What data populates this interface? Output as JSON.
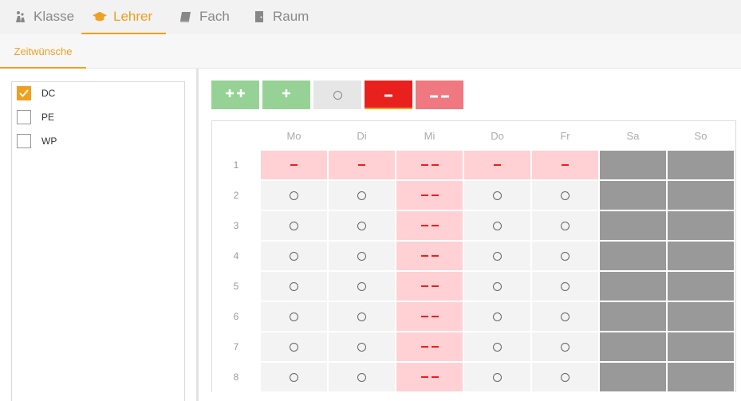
{
  "tabs": [
    {
      "label": "Klasse",
      "icon": "people-icon",
      "active": false
    },
    {
      "label": "Lehrer",
      "icon": "graduation-cap-icon",
      "active": true
    },
    {
      "label": "Fach",
      "icon": "book-icon",
      "active": false
    },
    {
      "label": "Raum",
      "icon": "door-icon",
      "active": false
    }
  ],
  "subtab": {
    "label": "Zeitwünsche"
  },
  "teachers": [
    {
      "label": "DC",
      "checked": true
    },
    {
      "label": "PE",
      "checked": false
    },
    {
      "label": "WP",
      "checked": false
    }
  ],
  "modes": [
    "++",
    "+",
    "○",
    "−",
    "−−"
  ],
  "colors": {
    "accent": "#f0a020",
    "positive": "#96d296",
    "negative": "#e8201e",
    "negative_soft": "#f07880",
    "blocked": "#999999"
  },
  "days": [
    "Mo",
    "Di",
    "Mi",
    "Do",
    "Fr",
    "Sa",
    "So"
  ],
  "periods": [
    "1",
    "2",
    "3",
    "4",
    "5",
    "6",
    "7",
    "8"
  ],
  "preferences": [
    [
      "-",
      "-",
      "--",
      "-",
      "-",
      "x",
      "x"
    ],
    [
      "o",
      "o",
      "--",
      "o",
      "o",
      "x",
      "x"
    ],
    [
      "o",
      "o",
      "--",
      "o",
      "o",
      "x",
      "x"
    ],
    [
      "o",
      "o",
      "--",
      "o",
      "o",
      "x",
      "x"
    ],
    [
      "o",
      "o",
      "--",
      "o",
      "o",
      "x",
      "x"
    ],
    [
      "o",
      "o",
      "--",
      "o",
      "o",
      "x",
      "x"
    ],
    [
      "o",
      "o",
      "--",
      "o",
      "o",
      "x",
      "x"
    ],
    [
      "o",
      "o",
      "--",
      "o",
      "o",
      "x",
      "x"
    ]
  ]
}
